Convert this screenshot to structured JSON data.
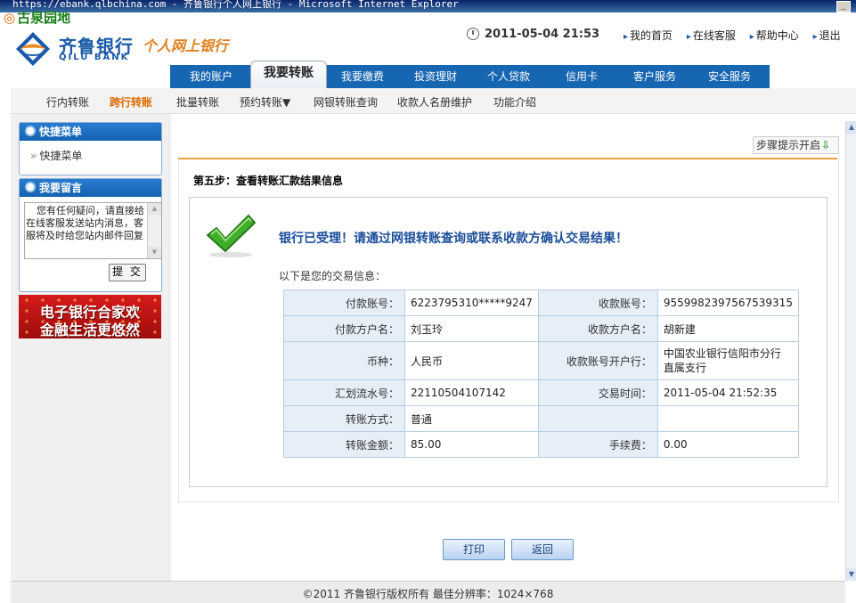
{
  "window": {
    "title": "https://ebank.qlbchina.com - 齐鲁银行个人网上银行 - Microsoft Internet Explorer",
    "watermark": "古泉园地"
  },
  "header": {
    "bank_name_cn": "齐鲁银行",
    "bank_name_en": "QILU BANK",
    "tagline": "个人网上银行",
    "datetime": "2011-05-04  21:53",
    "top_links": [
      "我的首页",
      "在线客服",
      "帮助中心",
      "退出"
    ]
  },
  "main_nav": [
    "我的账户",
    "我要转账",
    "我要缴费",
    "投资理财",
    "个人贷款",
    "信用卡",
    "客户服务",
    "安全服务"
  ],
  "sub_nav": [
    "行内转账",
    "跨行转账",
    "批量转账",
    "预约转账▼",
    "网银转账查询",
    "收款人名册维护",
    "功能介绍"
  ],
  "sidebar": {
    "quick_menu_title": "快捷菜单",
    "quick_menu_link": "快捷菜单",
    "message_title": "我要留言",
    "message_text": "您有任何疑问，请直接给在线客服发送站内消息，客服将及时给您站内邮件回复",
    "submit_label": "提 交",
    "banner_line1": "电子银行合家欢",
    "banner_line2": "金融生活更悠然"
  },
  "content": {
    "steps_toggle": "步骤提示开启",
    "step_title": "第五步：查看转账汇款结果信息",
    "success_message": "银行已受理！请通过网银转账查询或联系收款方确认交易结果！",
    "info_title": "以下是您的交易信息：",
    "rows": [
      {
        "l1": "付款账号：",
        "v1": "6223795310*****9247",
        "l2": "收款账号：",
        "v2": "9559982397567539315"
      },
      {
        "l1": "付款方户名：",
        "v1": "刘玉玲",
        "l2": "收款方户名：",
        "v2": "胡新建"
      },
      {
        "l1": "币种：",
        "v1": "人民币",
        "l2": "收款账号开户行：",
        "v2a": "中国农业银行信阳市分行",
        "v2b": "直属支行"
      },
      {
        "l1": "汇划流水号：",
        "v1": "22110504107142",
        "l2": "交易时间：",
        "v2": "2011-05-04  21:52:35"
      },
      {
        "l1": "转账方式：",
        "v1": "普通",
        "l2": "",
        "v2": ""
      },
      {
        "l1": "转账金额：",
        "v1": "85.00",
        "l2": "手续费：",
        "v2": "0.00"
      }
    ],
    "print_label": "打印",
    "back_label": "返回"
  },
  "footer": "©2011 齐鲁银行版权所有 最佳分辨率：1024×768",
  "colors": {
    "brand_blue": "#1766b2",
    "active_subnav": "#e06a00",
    "accent_orange": "#f0a040"
  }
}
